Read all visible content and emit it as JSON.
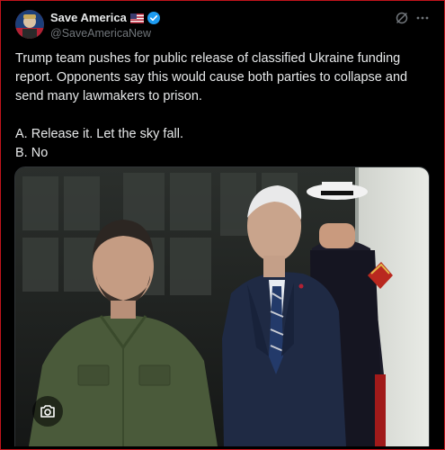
{
  "post": {
    "author_name": "Save America",
    "author_handle": "@SaveAmericaNew",
    "flag_icon": "us-flag-icon",
    "verified_icon": "verified-badge-icon",
    "lines": [
      "Trump team pushes for public release of classified Ukraine funding",
      "report. Opponents say this would cause both parties to collapse and",
      "send many lawmakers to prison."
    ],
    "option_a": "A. Release it. Let the sky fall.",
    "option_b": "B. No"
  },
  "actions": {
    "grok_icon": "grok-icon",
    "more_icon": "more-options-icon"
  },
  "media": {
    "camera_icon": "camera-icon",
    "accent_colors": {
      "suit": "#1f2a44",
      "shirt": "#4a5a3a",
      "marine_uniform": "#a11a1a",
      "frame_border": "#c0141c"
    }
  }
}
